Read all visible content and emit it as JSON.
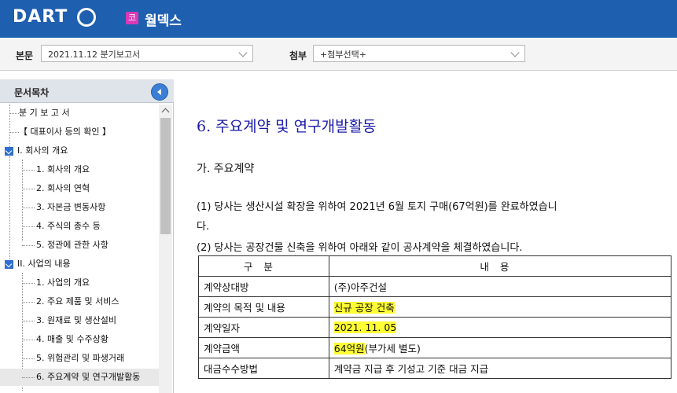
{
  "header": {
    "logo_text": "DART",
    "company_badge": "코",
    "company_name": "월덱스",
    "bg_color": "#1f5fb0"
  },
  "toolbar": {
    "main_label": "본문",
    "main_value": "2021.11.12  분기보고서",
    "attach_label": "첨부",
    "attach_value": "+첨부선택+"
  },
  "sidebar": {
    "title": "문서목차",
    "items": [
      {
        "label": "분 기 보 고 서"
      },
      {
        "label": "【 대표이사 등의 확인 】"
      },
      {
        "label": "I. 회사의 개요"
      },
      {
        "label": "1. 회사의 개요"
      },
      {
        "label": "2. 회사의 연혁"
      },
      {
        "label": "3. 자본금 변동사항"
      },
      {
        "label": "4. 주식의 총수 등"
      },
      {
        "label": "5. 정관에 관한 사항"
      },
      {
        "label": "II. 사업의 내용"
      },
      {
        "label": "1. 사업의 개요"
      },
      {
        "label": "2. 주요 제품 및 서비스"
      },
      {
        "label": "3. 원재료 및 생산설비"
      },
      {
        "label": "4. 매출 및 수주상황"
      },
      {
        "label": "5. 위험관리 및 파생거래"
      },
      {
        "label": "6. 주요계약 및 연구개발활동"
      }
    ]
  },
  "content": {
    "title": "6. 주요계약 및 연구개발활동",
    "subheading": "가. 주요계약",
    "para1_line1": "(1) 당사는 생산시설 확장을 위하여 2021년 6월 토지 구매(67억원)를 완료하였습니",
    "para1_line2": "다.",
    "para2": "(2) 당사는 공장건물 신축을 위하여 아래와 같이 공사계약을 체결하였습니다.",
    "table": {
      "col1_header": "구분",
      "col2_header": "내용",
      "rows": [
        {
          "label": "계약상대방",
          "value": "(주)아주건설"
        },
        {
          "label": "계약의 목적 및 내용",
          "value": "신규 공장 건축"
        },
        {
          "label": "계약일자",
          "value": "2021. 11. 05"
        },
        {
          "label": "계약금액",
          "value_highlight": "64억원",
          "value_rest": "(부가세 별도)"
        },
        {
          "label": "대금수수방법",
          "value": "계약금 지급 후 기성고 기준 대금 지급"
        }
      ]
    },
    "highlight_color": "#ffff33"
  }
}
